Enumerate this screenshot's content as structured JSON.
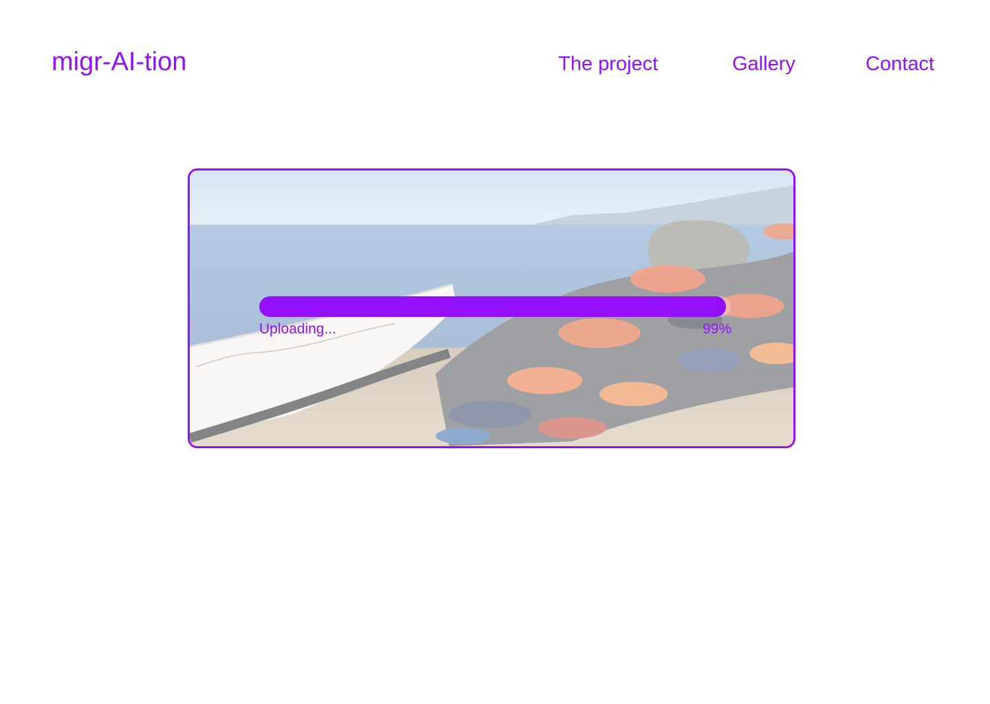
{
  "brand": {
    "name": "migr-AI-tion"
  },
  "nav": {
    "items": [
      {
        "label": "The project"
      },
      {
        "label": "Gallery"
      },
      {
        "label": "Contact"
      }
    ]
  },
  "upload": {
    "status": "Uploading...",
    "percent_label": "99%",
    "progress_fraction": 0.99
  },
  "colors": {
    "accent": "#9410fb",
    "background": "#ffffff"
  }
}
